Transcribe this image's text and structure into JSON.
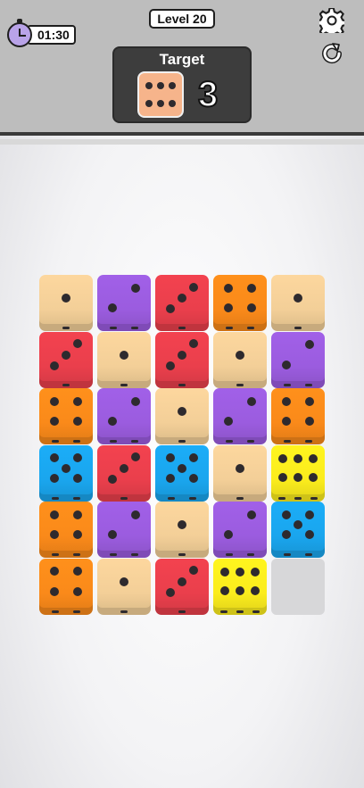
{
  "header": {
    "timer_text": "01:30",
    "level_label": "Level 20",
    "target_title": "Target",
    "target_die": {
      "value": 6,
      "color": "#f6b48b"
    },
    "target_count": "3",
    "icons": [
      "stopwatch-icon",
      "gear-icon",
      "restart-icon"
    ]
  },
  "colors": {
    "beige": "#f3cf98",
    "purple": "#9b5cdf",
    "red": "#ea3f4c",
    "orange": "#fa8a1a",
    "blue": "#1aa6ee",
    "yellow": "#fbec1d",
    "empty": "#d7d7d9"
  },
  "board": {
    "rows": 6,
    "cols": 5,
    "cells": [
      [
        {
          "color": "beige",
          "value": 1
        },
        {
          "color": "purple",
          "value": 2
        },
        {
          "color": "red",
          "value": 3
        },
        {
          "color": "orange",
          "value": 4
        },
        {
          "color": "beige",
          "value": 1
        }
      ],
      [
        {
          "color": "red",
          "value": 3
        },
        {
          "color": "beige",
          "value": 1
        },
        {
          "color": "red",
          "value": 3
        },
        {
          "color": "beige",
          "value": 1
        },
        {
          "color": "purple",
          "value": 2
        }
      ],
      [
        {
          "color": "orange",
          "value": 4
        },
        {
          "color": "purple",
          "value": 2
        },
        {
          "color": "beige",
          "value": 1
        },
        {
          "color": "purple",
          "value": 2
        },
        {
          "color": "orange",
          "value": 4
        }
      ],
      [
        {
          "color": "blue",
          "value": 5
        },
        {
          "color": "red",
          "value": 3
        },
        {
          "color": "blue",
          "value": 5
        },
        {
          "color": "beige",
          "value": 1
        },
        {
          "color": "yellow",
          "value": 6
        }
      ],
      [
        {
          "color": "orange",
          "value": 4
        },
        {
          "color": "purple",
          "value": 2
        },
        {
          "color": "beige",
          "value": 1
        },
        {
          "color": "purple",
          "value": 2
        },
        {
          "color": "blue",
          "value": 5
        }
      ],
      [
        {
          "color": "orange",
          "value": 4
        },
        {
          "color": "beige",
          "value": 1
        },
        {
          "color": "red",
          "value": 3
        },
        {
          "color": "yellow",
          "value": 6
        },
        {
          "color": "empty",
          "value": 0
        }
      ]
    ]
  }
}
